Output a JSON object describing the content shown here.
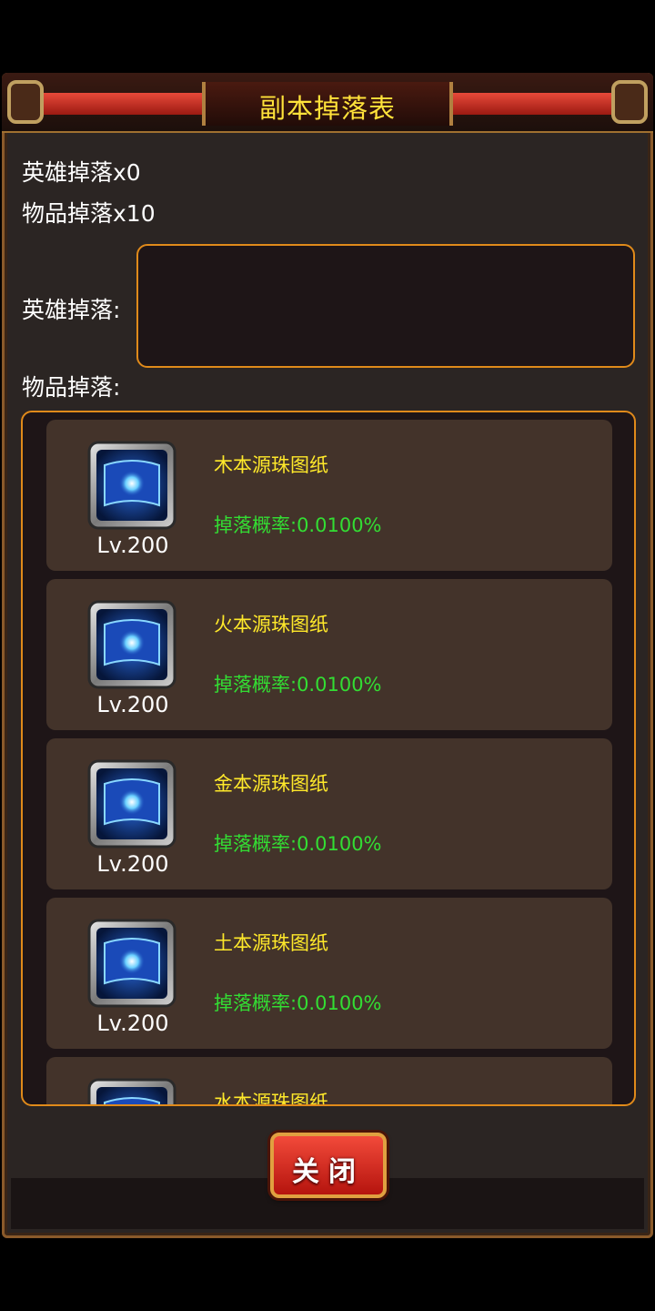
{
  "dialog": {
    "title": "副本掉落表",
    "hero_drop_count": "英雄掉落x0",
    "item_drop_count": "物品掉落x10",
    "hero_drop_label": "英雄掉落:",
    "item_drop_label": "物品掉落:"
  },
  "items": [
    {
      "name": "木本源珠图纸",
      "rate": "掉落概率:0.0100%",
      "level": "Lv.200",
      "icon": "scroll-blueprint-icon"
    },
    {
      "name": "火本源珠图纸",
      "rate": "掉落概率:0.0100%",
      "level": "Lv.200",
      "icon": "scroll-blueprint-icon"
    },
    {
      "name": "金本源珠图纸",
      "rate": "掉落概率:0.0100%",
      "level": "Lv.200",
      "icon": "scroll-blueprint-icon"
    },
    {
      "name": "土本源珠图纸",
      "rate": "掉落概率:0.0100%",
      "level": "Lv.200",
      "icon": "scroll-blueprint-icon"
    },
    {
      "name": "水本源珠图纸",
      "level": "",
      "icon": "scroll-blueprint-icon"
    }
  ],
  "buttons": {
    "close_label": "关闭"
  },
  "colors": {
    "title": "#ffe23a",
    "item_name": "#ffe92a",
    "drop_rate": "#33dd33",
    "frame_border": "#e08a1a",
    "button_red": "#d8281e"
  }
}
